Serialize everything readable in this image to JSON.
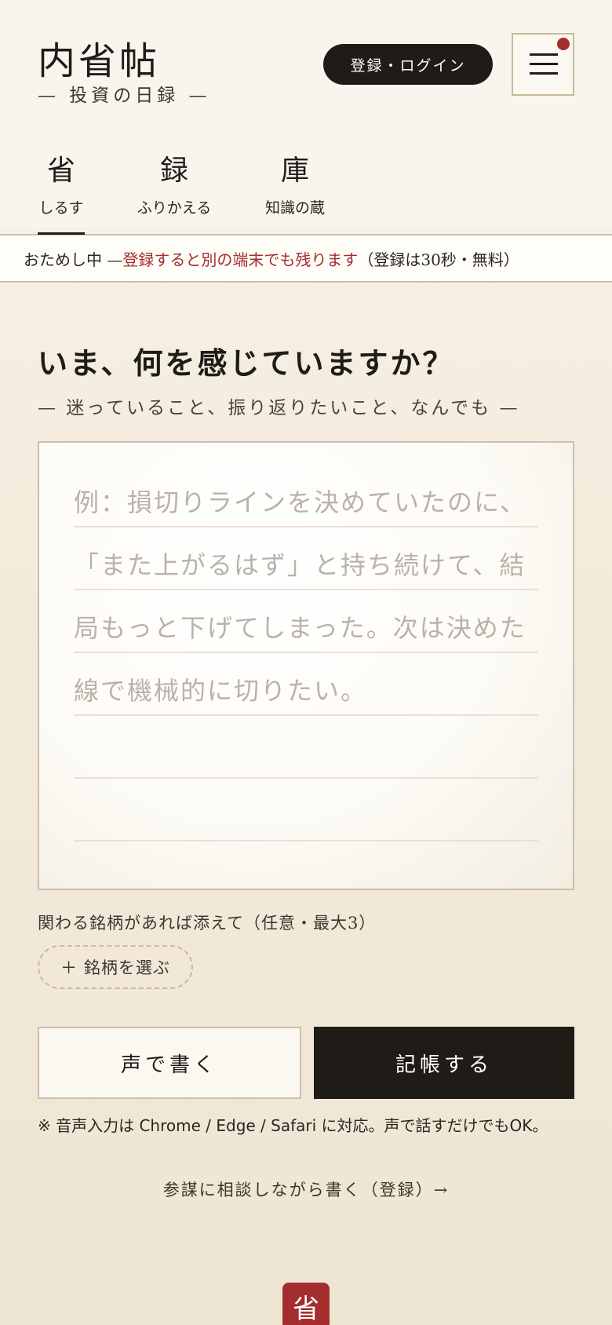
{
  "header": {
    "brand_title": "内省帖",
    "brand_subtitle": "— 投資の日録 —",
    "login_label": "登録・ログイン",
    "menu_icon": "hamburger-icon",
    "notification_color": "#a42d2d"
  },
  "tabs": [
    {
      "kanji": "省",
      "label": "しるす",
      "active": true
    },
    {
      "kanji": "録",
      "label": "ふりかえる",
      "active": false
    },
    {
      "kanji": "庫",
      "label": "知識の蔵",
      "active": false
    }
  ],
  "notice": {
    "prefix": "おためし中 — ",
    "highlight": "登録すると別の端末でも残ります",
    "suffix": "（登録は30秒・無料）"
  },
  "entry": {
    "question": "いま、何を感じていますか？",
    "subtitle": "— 迷っていること、振り返りたいこと、なんでも —",
    "placeholder": "例：損切りラインを決めていたのに、「また上がるはず」と持ち続けて、結局もっと下げてしまった。次は決めた線で機械的に切りたい。"
  },
  "tickers": {
    "label": "関わる銘柄があれば添えて（任意・最大3）",
    "button_label": "＋ 銘柄を選ぶ"
  },
  "actions": {
    "voice_label": "声で書く",
    "submit_label": "記帳する",
    "voice_note": "※ 音声入力は Chrome / Edge / Safari に対応。声で話すだけでもOK。"
  },
  "consult_link": "参謀に相談しながら書く（登録）→",
  "footer": {
    "badge": "省"
  },
  "colors": {
    "accent": "#a42d2d",
    "ink": "#1f1b16",
    "paper": "#f8f5ee"
  }
}
